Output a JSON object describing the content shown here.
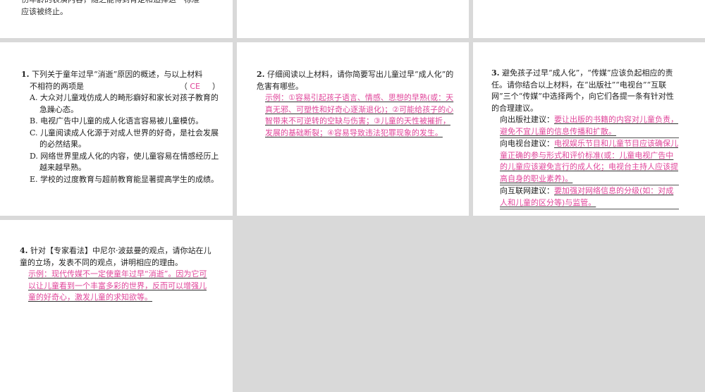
{
  "top": {
    "line1": "伤年龄的表演内容，随之能得到肯定和追捧这一标准",
    "line2": "应该被终止。"
  },
  "q1": {
    "number": "1.",
    "stem1": "下列关于童年过早“消逝”原因的概述，与以上材料",
    "stem2": "不相符的两项是",
    "paren_open": "（",
    "answer": "CE",
    "paren_close": "）",
    "options": [
      "A. 大众对儿童戏仿成人的畸形癖好和家长对孩子教育的急躁心态。",
      "B. 电视广告中儿童的成人化语言容易被儿童模仿。",
      "C. 儿童阅读成人化源于对成人世界的好奇，是社会发展的必然结果。",
      "D. 网络世界里成人化的内容，使儿童容易在情感经历上越来越早熟。",
      "E. 学校的过度教育与超前教育能显著提高学生的成绩。"
    ]
  },
  "q2": {
    "number": "2.",
    "stem": "仔细阅读以上材料，请你简要写出儿童过早“成人化”的危害有哪些。",
    "answer": "示例：①容易引起孩子语言、情感、思想的早熟(或：天真无邪、可塑性和好奇心逐渐退化)；②可能给孩子的心智带来不可逆转的空缺与伤害；③儿童的天性被摧折，发展的基础断裂；④容易导致违法犯罪现象的发生。"
  },
  "q3": {
    "number": "3.",
    "stem": "避免孩子过早“成人化”，“传媒”应该负起相应的责任。请你结合以上材料，在“出版社”“电视台”“互联网”三个“传媒”中选择两个，向它们各提一条有针对性的合理建议。",
    "items": [
      {
        "label": "向出版社建议：",
        "text": "要让出版的书籍的内容对儿童负责，避免不宜儿童的信息传播和扩散。"
      },
      {
        "label": "向电视台建议：",
        "text": "电视娱乐节目和儿童节目应该确保儿童正确的参与形式和评价标准(或：儿童电视广告中的儿童应该避免言行的成人化；电视台主持人应该提高自身的职业素养)。"
      },
      {
        "label": "向互联网建议：",
        "text": "要加强对网络信息的分级(如：对成人和儿童的区分等)与监管。"
      }
    ]
  },
  "q4": {
    "number": "4.",
    "stem": "针对【专家看法】中尼尔·波兹曼的观点，请你站在儿童的立场，发表不同的观点，讲明相应的理由。",
    "answer": "示例：现代传媒不一定使童年过早“消逝”。因为它可以让儿童看到一个丰富多彩的世界，反而可以增强儿童的好奇心，激发儿童的求知欲等。"
  }
}
